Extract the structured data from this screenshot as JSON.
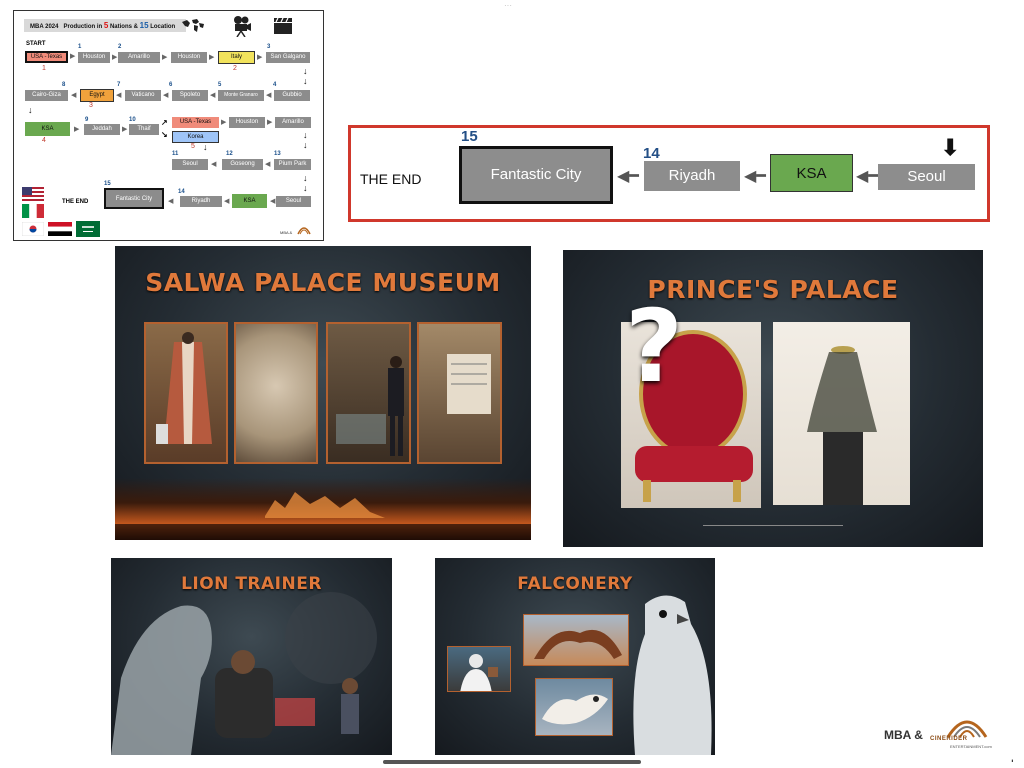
{
  "route_map": {
    "header_prefix": "MBA 2024",
    "header_mid": "Production in",
    "nations_count": "5",
    "nations_label": "Nations &",
    "locations_count": "15",
    "locations_label": "Location",
    "start_label": "START",
    "end_label": "THE END",
    "footer_brand": "MBA &",
    "row1": [
      {
        "label": "USA -Texas",
        "num": ""
      },
      {
        "label": "Houston",
        "num": "1"
      },
      {
        "label": "Amarillo",
        "num": "2"
      },
      {
        "label": "Houston",
        "num": ""
      },
      {
        "label": "Italy",
        "num": ""
      },
      {
        "label": "San Galgano",
        "num": "3"
      }
    ],
    "row1_red_num": "1",
    "italy_red_num": "2",
    "row2": [
      {
        "label": "Cairo-Giza",
        "num": "8"
      },
      {
        "label": "Egypt",
        "num": ""
      },
      {
        "label": "Vaticano",
        "num": "7"
      },
      {
        "label": "Spoleto",
        "num": "6"
      },
      {
        "label": "Monte Granaro",
        "num": "5"
      },
      {
        "label": "Gubbio",
        "num": "4"
      }
    ],
    "egypt_red_num": "3",
    "row3": [
      {
        "label": "KSA",
        "num": ""
      },
      {
        "label": "Jeddah",
        "num": "9"
      },
      {
        "label": "Thaif",
        "num": "10"
      },
      {
        "label": "USA -Texas",
        "num": ""
      },
      {
        "label": "Houston",
        "num": ""
      },
      {
        "label": "Amarillo",
        "num": ""
      }
    ],
    "ksa_red_num": "4",
    "korea_label": "Korea",
    "korea_red_num": "5",
    "row4": [
      {
        "label": "Seoul",
        "num": "11"
      },
      {
        "label": "Goseong",
        "num": "12"
      },
      {
        "label": "Pium Park",
        "num": "13"
      }
    ],
    "row5": [
      {
        "label": "Fantastic City",
        "num": "15"
      },
      {
        "label": "Riyadh",
        "num": "14"
      },
      {
        "label": "KSA",
        "num": ""
      },
      {
        "label": "Seoul",
        "num": ""
      }
    ],
    "flags": [
      "usa-flag",
      "italy-flag",
      "korea-flag",
      "egypt-flag",
      "saudi-flag"
    ]
  },
  "end_panel": {
    "end_label": "THE END",
    "fantastic_city": "Fantastic City",
    "fantastic_num": "15",
    "riyadh": "Riyadh",
    "riyadh_num": "14",
    "ksa": "KSA",
    "seoul": "Seoul"
  },
  "slides": {
    "salwa": {
      "title": "SALWA PALACE MUSEUM"
    },
    "prince": {
      "title": "PRINCE'S PALACE",
      "question_mark": "?"
    },
    "lion": {
      "title": "LION TRAINER"
    },
    "falconery": {
      "title": "FALCONERY"
    }
  },
  "footer": {
    "brand": "MBA &",
    "logo_text": "CINERIDER",
    "logo_sub": "ENTERTAINMENT.com"
  },
  "colors": {
    "accent_orange": "#e0793b",
    "route_gray": "#8c8c8c",
    "end_border": "#d0382c",
    "ksa_green": "#6aa84f",
    "italy_yellow": "#f2e35c",
    "egypt_orange": "#f0a23c",
    "usa_pink": "#f08b7a",
    "korea_blue": "#9fc5f8"
  }
}
